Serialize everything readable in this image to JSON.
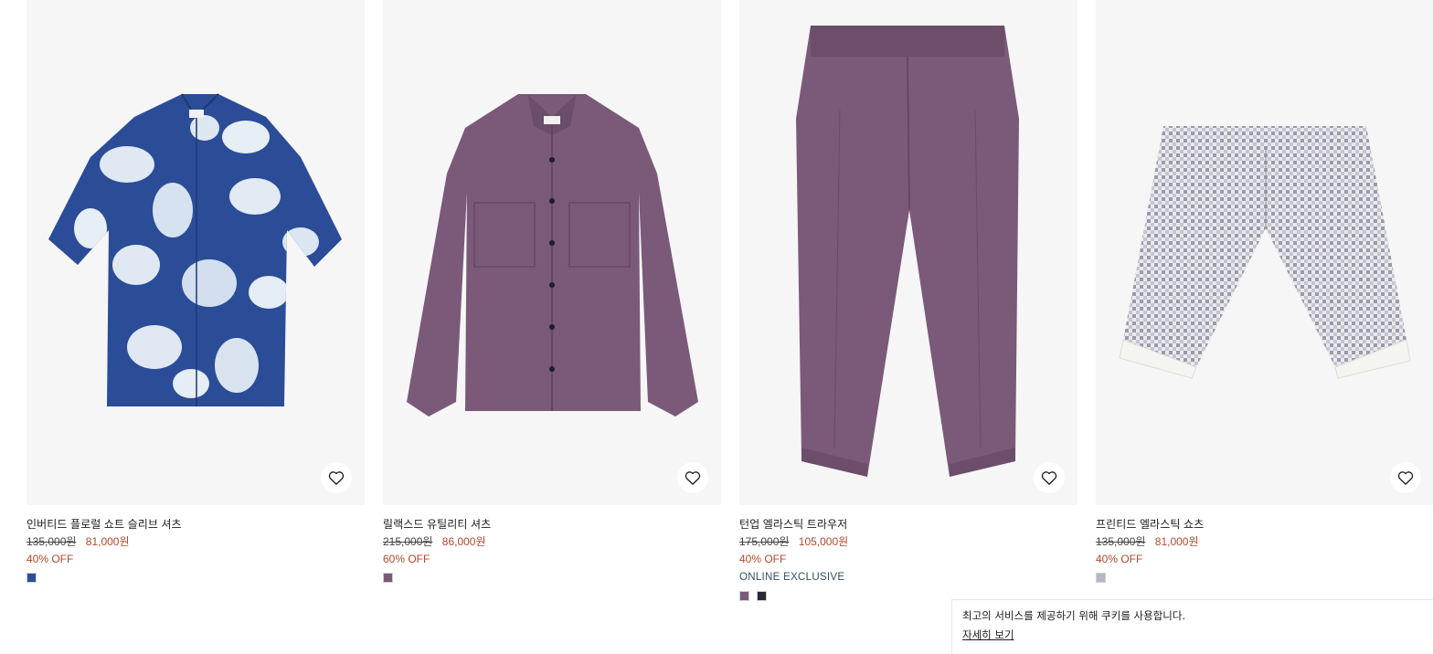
{
  "products": [
    {
      "name": "인버티드 플로럴 쇼트 슬리브 셔츠",
      "old_price": "135,000원",
      "new_price": "81,000원",
      "discount": "40% OFF",
      "exclusive": "",
      "swatches": [
        "#2d4f9a"
      ],
      "favorite_icon": "heart-outline-icon"
    },
    {
      "name": "릴랙스드 유틸리티 셔츠",
      "old_price": "215,000원",
      "new_price": "86,000원",
      "discount": "60% OFF",
      "exclusive": "",
      "swatches": [
        "#7a5a78"
      ],
      "favorite_icon": "heart-outline-icon"
    },
    {
      "name": "턴업 엘라스틱 트라우저",
      "old_price": "175,000원",
      "new_price": "105,000원",
      "discount": "40% OFF",
      "exclusive": "ONLINE EXCLUSIVE",
      "swatches": [
        "#7a5a78",
        "#2a2a35"
      ],
      "favorite_icon": "heart-outline-icon"
    },
    {
      "name": "프린티드 엘라스틱 쇼츠",
      "old_price": "135,000원",
      "new_price": "81,000원",
      "discount": "40% OFF",
      "exclusive": "",
      "swatches": [
        "#b8b8c2"
      ],
      "favorite_icon": "heart-outline-icon"
    }
  ],
  "cookie_banner": {
    "message": "최고의 서비스를 제공하기 위해 쿠키를 사용합니다.",
    "link": "자세히 보기"
  },
  "colors": {
    "sale": "#b3482c",
    "exclusive": "#2f4f62",
    "image_bg": "#f6f6f6"
  }
}
